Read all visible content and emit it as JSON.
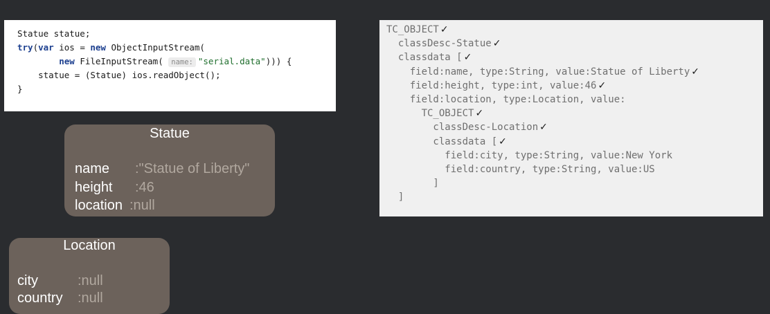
{
  "code": {
    "line1": "Statue statue;",
    "line2_kw1": "try",
    "line2_p1": "(",
    "line2_kw2": "var",
    "line2_p2": " ios = ",
    "line2_kw3": "new",
    "line2_p3": " ObjectInputStream(",
    "line3_indent": "        ",
    "line3_kw": "new",
    "line3_p1": " FileInputStream( ",
    "line3_hint": "name:",
    "line3_str": "\"serial.data\"",
    "line3_p2": "))) {",
    "line4": "    statue = (Statue) ios.readObject();",
    "line5": "}"
  },
  "tree": {
    "lines": [
      {
        "text": "TC_OBJECT",
        "check": "✓"
      },
      {
        "text": "  classDesc-Statue",
        "check": "✓"
      },
      {
        "text": "  classdata [",
        "check": "✓"
      },
      {
        "text": "    field:name, type:String, value:Statue of Liberty",
        "check": "✓"
      },
      {
        "text": "    field:height, type:int, value:46",
        "check": "✓"
      },
      {
        "text": "    field:location, type:Location, value:",
        "check": ""
      },
      {
        "text": "      TC_OBJECT",
        "check": "✓"
      },
      {
        "text": "        classDesc-Location",
        "check": "✓"
      },
      {
        "text": "        classdata [",
        "check": "✓"
      },
      {
        "text": "          field:city, type:String, value:New York",
        "check": ""
      },
      {
        "text": "          field:country, type:String, value:US",
        "check": ""
      },
      {
        "text": "        ]",
        "check": ""
      },
      {
        "text": "  ]",
        "check": ""
      }
    ]
  },
  "statue_box": {
    "title": "Statue",
    "fields": [
      {
        "name": "name",
        "value": ":\"Statue of Liberty\""
      },
      {
        "name": "height",
        "value": ":46"
      },
      {
        "name": "location",
        "value": ":null"
      }
    ]
  },
  "location_box": {
    "title": "Location",
    "fields": [
      {
        "name": "city",
        "value": ":null"
      },
      {
        "name": "country",
        "value": ":null"
      }
    ]
  }
}
